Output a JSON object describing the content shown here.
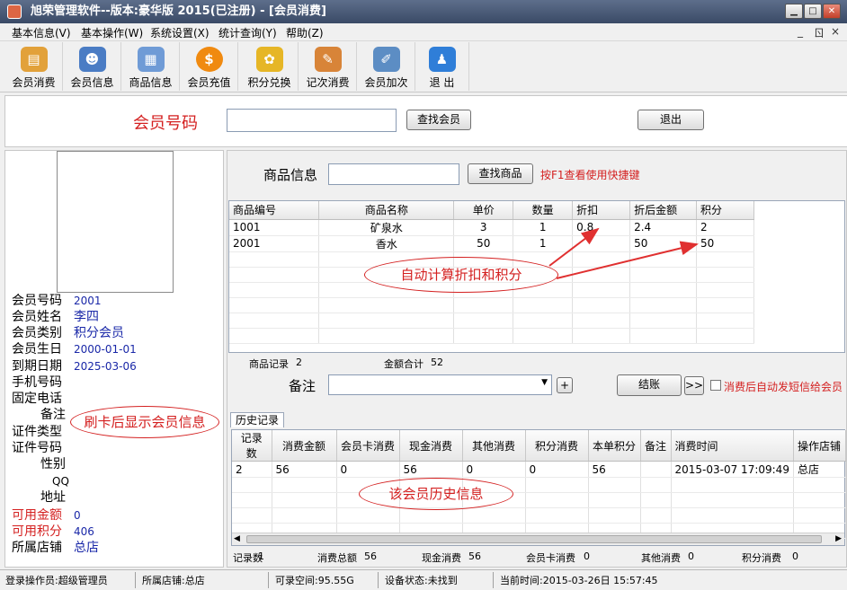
{
  "window": {
    "title": "旭荣管理软件--版本:豪华版 2015(已注册) - [会员消费]",
    "min": "▁",
    "max": "□",
    "close": "✕"
  },
  "menu": {
    "items": [
      "基本信息(V)",
      "基本操作(W)",
      "系统设置(X)",
      "统计查询(Y)",
      "帮助(Z)"
    ],
    "mdi": [
      "_",
      "ㄖ",
      "×"
    ]
  },
  "toolbar": [
    {
      "label": "会员消费",
      "icon": "member-cards-icon",
      "color": "#e2a13a",
      "glyph": "▤"
    },
    {
      "label": "会员信息",
      "icon": "members-icon",
      "color": "#4a7cc4",
      "glyph": "☻"
    },
    {
      "label": "商品信息",
      "icon": "goods-grid-icon",
      "color": "#6f9bd6",
      "glyph": "▦"
    },
    {
      "label": "会员充值",
      "icon": "dollar-coin-icon",
      "color": "#f08a10",
      "glyph": "$"
    },
    {
      "label": "积分兑换",
      "icon": "points-exchange-icon",
      "color": "#e6b626",
      "glyph": "✿"
    },
    {
      "label": "记次消费",
      "icon": "count-consume-icon",
      "color": "#d88438",
      "glyph": "✎"
    },
    {
      "label": "会员加次",
      "icon": "add-count-icon",
      "color": "#5c8dc4",
      "glyph": "✐"
    },
    {
      "label": "退 出",
      "icon": "exit-person-icon",
      "color": "#2f7ed8",
      "glyph": "♟"
    }
  ],
  "search": {
    "label": "会员号码",
    "value": "",
    "find_btn": "查找会员",
    "exit_btn": "退出"
  },
  "member": {
    "labels": [
      "会员号码",
      "会员姓名",
      "会员类别",
      "会员生日",
      "到期日期",
      "手机号码",
      "固定电话",
      "备注",
      "证件类型",
      "证件号码",
      "性别",
      "QQ",
      "地址",
      "可用金额",
      "可用积分",
      "所属店铺"
    ],
    "values": {
      "会员号码": "2001",
      "会员姓名": "李四",
      "会员类别": "积分会员",
      "会员生日": "2000-01-01",
      "到期日期": "2025-03-06",
      "可用金额": "0",
      "可用积分": "406",
      "所属店铺": "总店"
    }
  },
  "goods": {
    "label": "商品信息",
    "value": "",
    "find_btn": "查找商品",
    "hint": "按F1查看使用快捷键",
    "columns": [
      "商品编号",
      "商品名称",
      "单价",
      "数量",
      "折扣",
      "折后金额",
      "积分"
    ],
    "rows": [
      [
        "1001",
        "矿泉水",
        "3",
        "1",
        "0.8",
        "2.4",
        "2"
      ],
      [
        "2001",
        "香水",
        "50",
        "1",
        "",
        "50",
        "50"
      ]
    ],
    "summary": {
      "records_label": "商品记录",
      "records": "2",
      "amount_label": "金额合计",
      "amount": "52"
    }
  },
  "remark": {
    "label": "备注",
    "value": "",
    "plus": "+",
    "checkout": "结账",
    "more": ">>",
    "sms": "消费后自动发短信给会员"
  },
  "history": {
    "tab": "历史记录",
    "columns": [
      "记录数",
      "消费金额",
      "会员卡消费",
      "现金消费",
      "其他消费",
      "积分消费",
      "本单积分",
      "备注",
      "消费时间",
      "操作店铺"
    ],
    "rows": [
      [
        "2",
        "56",
        "0",
        "56",
        "0",
        "0",
        "56",
        "",
        "2015-03-07 17:09:49",
        "总店"
      ]
    ],
    "footer": [
      [
        "记录数",
        "1"
      ],
      [
        "消费总额",
        "56"
      ],
      [
        "现金消费",
        "56"
      ],
      [
        "会员卡消费",
        "0"
      ],
      [
        "其他消费",
        "0"
      ],
      [
        "积分消费",
        "0"
      ]
    ]
  },
  "annotations": {
    "calc": "自动计算折扣和积分",
    "card": "刷卡后显示会员信息",
    "history": "该会员历史信息"
  },
  "status": {
    "operator": "登录操作员:超级管理员",
    "shop": "所属店铺:总店",
    "space": "可录空间:95.55G",
    "device": "设备状态:未找到",
    "time": "当前时间:2015-03-26日 15:57:45"
  }
}
